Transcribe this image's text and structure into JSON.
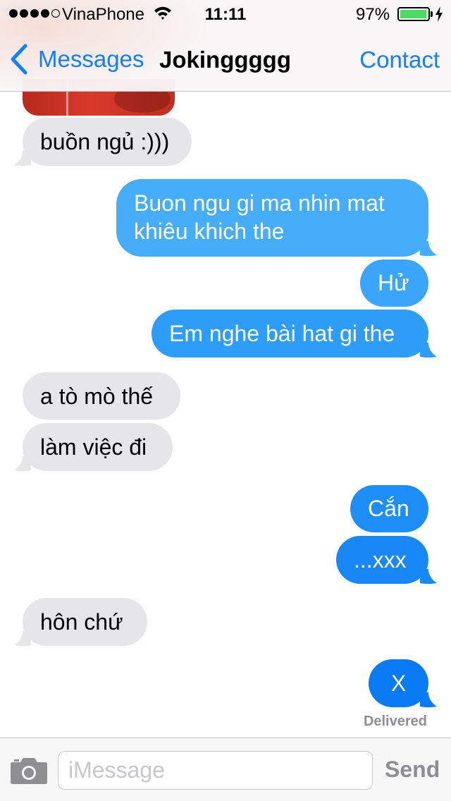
{
  "status_bar": {
    "carrier": "VinaPhone",
    "signal_bars_filled": 4,
    "signal_bars_total": 5,
    "time": "11:11",
    "battery_percent": "97%",
    "battery_level": 0.97,
    "battery_color": "#4cd964"
  },
  "nav": {
    "back_label": "Messages",
    "title": "Jokinggggg",
    "contact_label": "Contact",
    "accent_color": "#147efb"
  },
  "messages": [
    {
      "direction": "incoming",
      "type": "photo",
      "icon": "photo-thumbnail"
    },
    {
      "direction": "incoming",
      "text": "buồn ngủ :)))"
    },
    {
      "direction": "outgoing",
      "lines": [
        "Buon ngu gi ma nhin mat",
        "khiêu khich the"
      ]
    },
    {
      "direction": "outgoing",
      "text": "Hử"
    },
    {
      "direction": "outgoing",
      "text": "Em nghe bài hat gi the"
    },
    {
      "direction": "incoming",
      "text": "a tò mò thế"
    },
    {
      "direction": "incoming",
      "text": "làm việc đi"
    },
    {
      "direction": "outgoing",
      "text": "Cắn"
    },
    {
      "direction": "outgoing",
      "text": "...xxx"
    },
    {
      "direction": "incoming",
      "text": "hôn chứ"
    },
    {
      "direction": "outgoing",
      "text": "X"
    }
  ],
  "delivered_label": "Delivered",
  "input_bar": {
    "placeholder": "iMessage",
    "value": "",
    "send_label": "Send",
    "camera_icon": "camera-icon"
  },
  "colors": {
    "incoming_bubble": "#e5e5ea",
    "outgoing_gradient_top": "#4ab0fb",
    "outgoing_gradient_bottom": "#0a78f2"
  }
}
